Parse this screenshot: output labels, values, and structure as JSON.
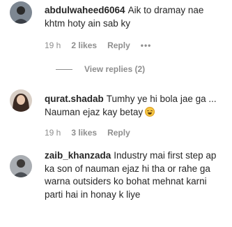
{
  "comments": [
    {
      "username": "abdulwaheed6064",
      "text": "Aik to dramay nae khtm hoty ain sab ky",
      "time": "19 h",
      "likes": "2 likes",
      "reply": "Reply",
      "more": "•••",
      "view_replies": "View replies (2)",
      "avatar_color": "#9aa3ad"
    },
    {
      "username": "qurat.shadab",
      "text": "Tumhy ye hi bola jae ga ... Nauman ejaz kay betay",
      "emoji": "grinning-squinting-face",
      "time": "19 h",
      "likes": "3 likes",
      "reply": "Reply",
      "avatar_color": "#c7b7a9"
    },
    {
      "username": "zaib_khanzada",
      "text": "Industry mai first step ap ka son of nauman ejaz hi tha or rahe ga warna outsiders ko bohat mehnat karni parti hai in honay k liye",
      "avatar_color": "#8c8f93"
    }
  ]
}
